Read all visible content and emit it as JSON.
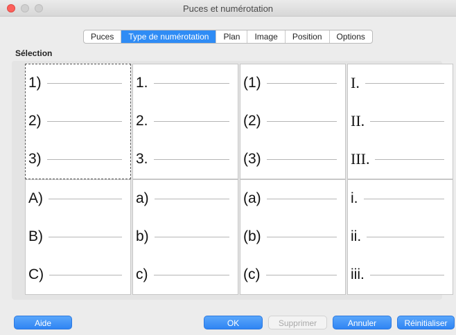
{
  "window": {
    "title": "Puces et numérotation"
  },
  "tabs": [
    {
      "label": "Puces",
      "active": false
    },
    {
      "label": "Type de numérotation",
      "active": true
    },
    {
      "label": "Plan",
      "active": false
    },
    {
      "label": "Image",
      "active": false
    },
    {
      "label": "Position",
      "active": false
    },
    {
      "label": "Options",
      "active": false
    }
  ],
  "selection": {
    "label": "Sélection",
    "cells": [
      {
        "style": "sans",
        "items": [
          "1)",
          "2)",
          "3)"
        ],
        "selected": true
      },
      {
        "style": "sans",
        "items": [
          "1.",
          "2.",
          "3."
        ],
        "selected": false
      },
      {
        "style": "sans",
        "items": [
          "(1)",
          "(2)",
          "(3)"
        ],
        "selected": false
      },
      {
        "style": "serif",
        "items": [
          "I.",
          "II.",
          "III."
        ],
        "selected": false
      },
      {
        "style": "sans",
        "items": [
          "A)",
          "B)",
          "C)"
        ],
        "selected": false
      },
      {
        "style": "sans",
        "items": [
          "a)",
          "b)",
          "c)"
        ],
        "selected": false
      },
      {
        "style": "sans",
        "items": [
          "(a)",
          "(b)",
          "(c)"
        ],
        "selected": false
      },
      {
        "style": "sans",
        "items": [
          "i.",
          "ii.",
          "iii."
        ],
        "selected": false
      }
    ]
  },
  "buttons": {
    "help": "Aide",
    "ok": "OK",
    "delete": "Supprimer",
    "cancel": "Annuler",
    "reset": "Réinitialiser"
  },
  "colors": {
    "accent": "#2f8cf5",
    "close_button": "#fc605b"
  }
}
